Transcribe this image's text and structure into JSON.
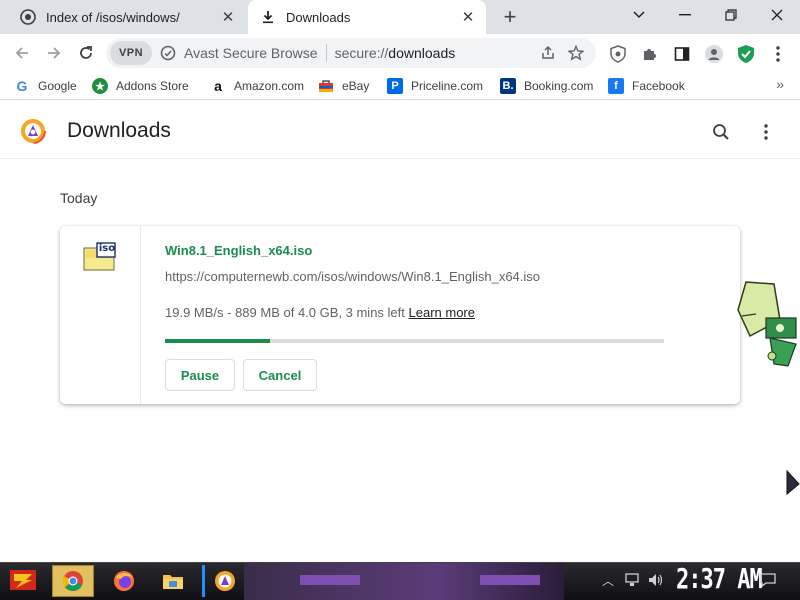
{
  "tabs": [
    {
      "title": "Index of /isos/windows/",
      "active": false
    },
    {
      "title": "Downloads",
      "active": true
    }
  ],
  "toolbar": {
    "vpn_label": "VPN",
    "brand": "Avast Secure Browse",
    "url_scheme": "secure://",
    "url_path": "downloads"
  },
  "bookmarks": [
    {
      "label": "Google",
      "icon": "google-icon"
    },
    {
      "label": "Addons Store",
      "icon": "addons-store-icon"
    },
    {
      "label": "Amazon.com",
      "icon": "amazon-icon"
    },
    {
      "label": "eBay",
      "icon": "ebay-icon"
    },
    {
      "label": "Priceline.com",
      "icon": "priceline-icon"
    },
    {
      "label": "Booking.com",
      "icon": "booking-icon"
    },
    {
      "label": "Facebook",
      "icon": "facebook-icon"
    }
  ],
  "page": {
    "title": "Downloads",
    "section_date": "Today"
  },
  "download": {
    "icon_label": "iso",
    "file_name": "Win8.1_English_x64.iso",
    "url": "https://computernewb.com/isos/windows/Win8.1_English_x64.iso",
    "status": "19.9 MB/s - 889 MB of 4.0 GB, 3 mins left",
    "learn_more": "Learn more",
    "progress_fraction": 0.21,
    "pause_label": "Pause",
    "cancel_label": "Cancel"
  },
  "taskbar": {
    "clock": "2:37 AM"
  },
  "colors": {
    "accent_green": "#1a8d4e",
    "tab_strip": "#dee1e6",
    "progress_track": "#dadce0"
  }
}
